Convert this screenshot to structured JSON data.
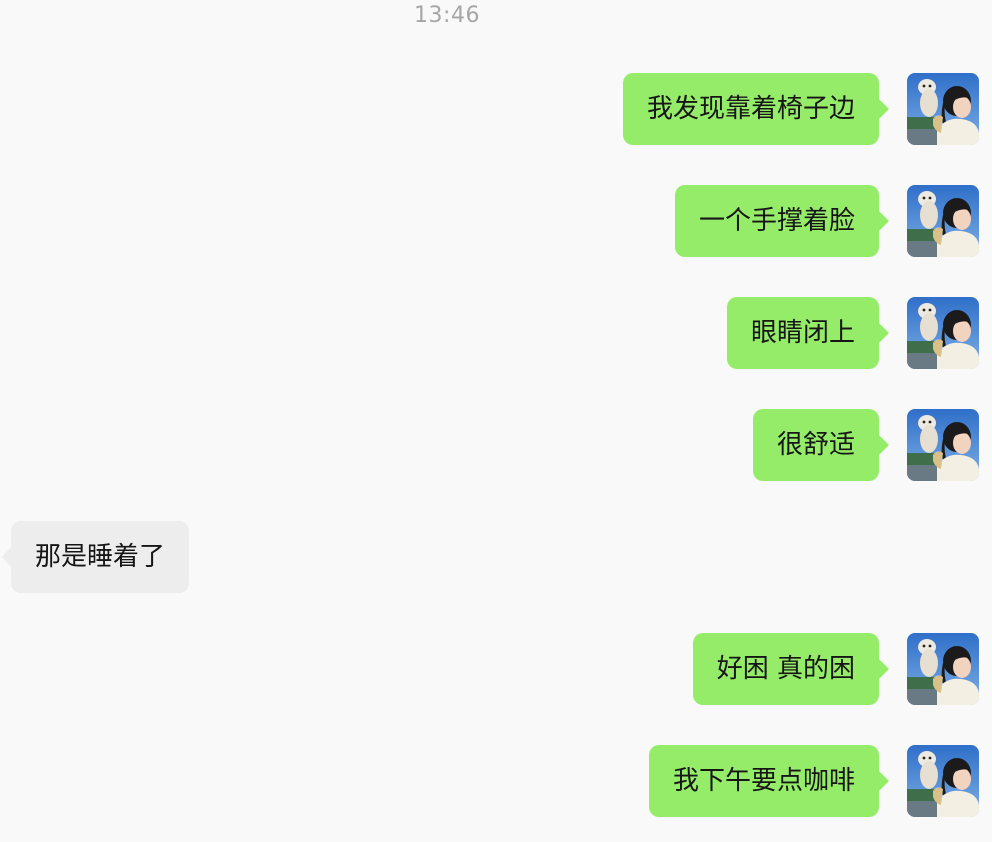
{
  "time": "13:46",
  "messages": [
    {
      "side": "out",
      "text": "我发现靠着椅子边"
    },
    {
      "side": "out",
      "text": "一个手撑着脸"
    },
    {
      "side": "out",
      "text": "眼睛闭上"
    },
    {
      "side": "out",
      "text": "很舒适"
    },
    {
      "side": "in",
      "text": "那是睡着了"
    },
    {
      "side": "out",
      "text": "好困 真的困"
    },
    {
      "side": "out",
      "text": "我下午要点咖啡"
    }
  ],
  "avatar_icon": "user-avatar-photo",
  "colors": {
    "outgoing_bubble": "#95ec69",
    "incoming_bubble": "#ededed",
    "background": "#f9f9f9",
    "timestamp": "#a6a6a6"
  }
}
